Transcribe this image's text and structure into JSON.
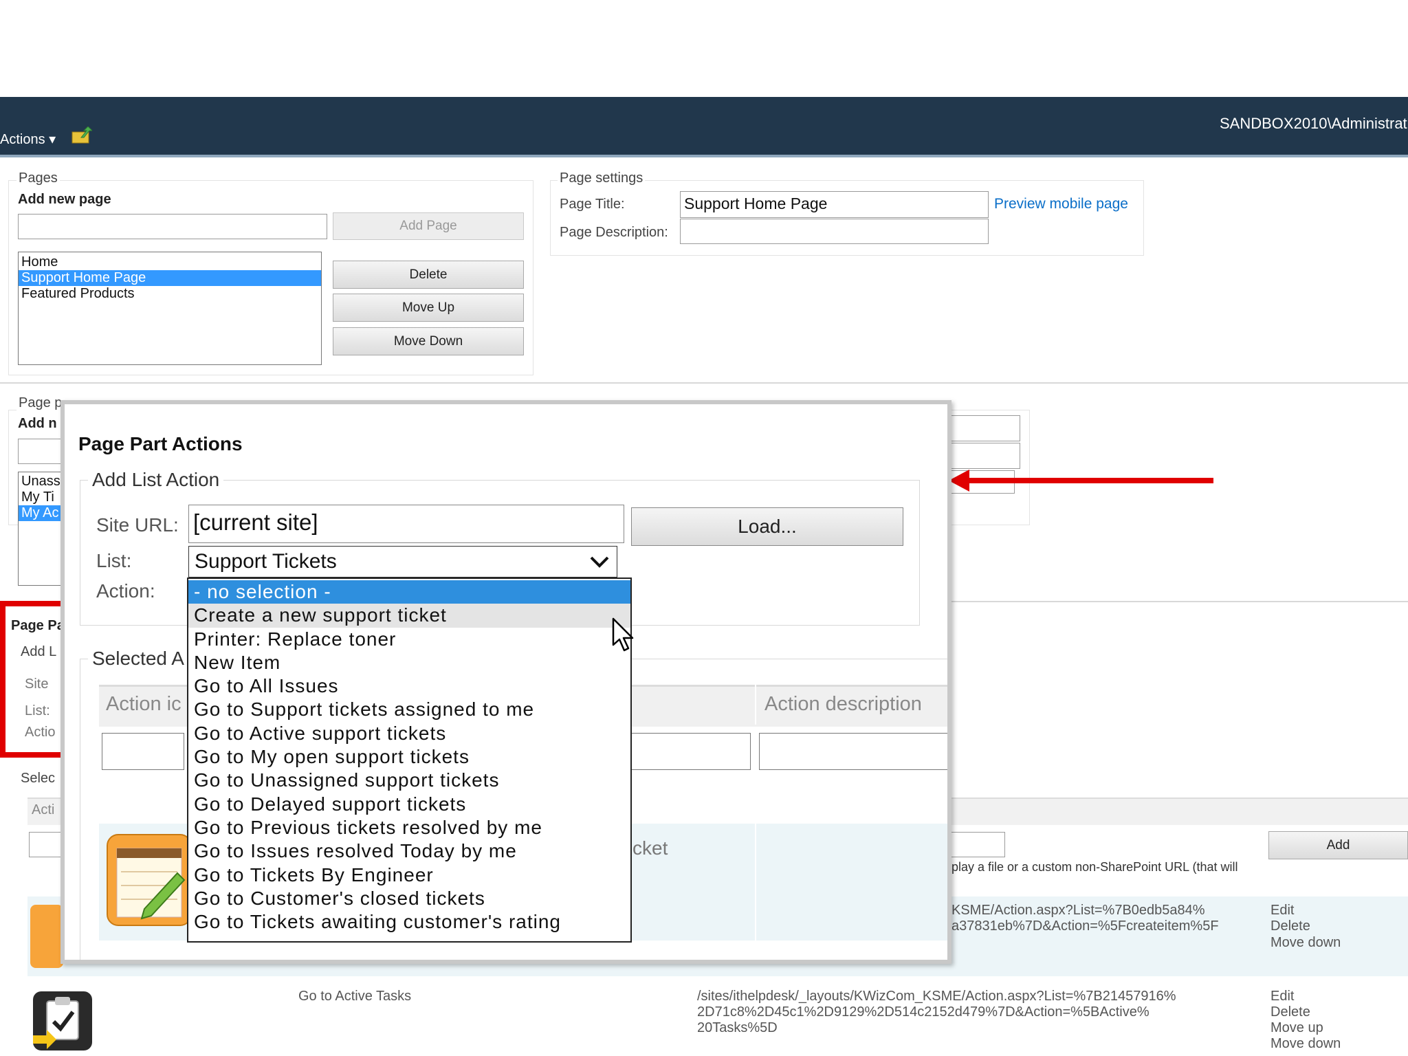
{
  "ribbon": {
    "actions_label": "Actions ▾",
    "upload_icon": "upload-folder-icon",
    "user": "SANDBOX2010\\Administrat"
  },
  "pages_panel": {
    "legend": "Pages",
    "add_new_label": "Add new page",
    "new_page_value": "",
    "add_page_button": "Add Page",
    "pages": [
      "Home",
      "Support Home Page",
      "Featured Products"
    ],
    "selected_index": 1,
    "delete_button": "Delete",
    "move_up_button": "Move Up",
    "move_down_button": "Move Down"
  },
  "page_settings": {
    "legend": "Page settings",
    "title_label": "Page Title:",
    "title_value": "Support Home Page",
    "description_label": "Page Description:",
    "description_value": "",
    "preview_link": "Preview mobile page"
  },
  "page_parts_panel": {
    "legend_partial": "Page p",
    "add_new_partial": "Add n",
    "items_partial": [
      "Unass",
      "My Ti",
      "My Ac"
    ]
  },
  "bg_lower": {
    "page_part_label": "Page Pa",
    "add_label": "Add L",
    "site_label": "Site",
    "list_label": "List:",
    "action_label": "Actio",
    "selected_label": "Selec",
    "acti_header": "Acti",
    "ticket_frag": "cket",
    "add_button": "Add",
    "help_text": "play a file or a custom non-SharePoint URL (that will",
    "row1_url_1": "KSME/Action.aspx?List=%7B0edb5a84%",
    "row1_url_2": "a37831eb%7D&Action=%5Fcreateitem%5F",
    "row1_links": [
      "Edit",
      "Delete",
      "Move down"
    ],
    "row2_title": "Go to Active Tasks",
    "row2_url": [
      "/sites/ithelpdesk/_layouts/KWizCom_KSME/Action.aspx?List=%7B21457916%",
      "2D71c8%2D45c1%2D9129%2D514c2152d479%7D&Action=%5BActive%",
      "20Tasks%5D"
    ],
    "row2_links": [
      "Edit",
      "Delete",
      "Move up",
      "Move down"
    ]
  },
  "modal": {
    "title": "Page Part Actions",
    "add_legend": "Add List Action",
    "site_url_label": "Site URL:",
    "site_url_value": "[current site]",
    "load_button": "Load...",
    "list_label": "List:",
    "list_value": "Support Tickets",
    "action_label": "Action:",
    "selected_legend": "Selected A",
    "col_action_icon": "Action ic",
    "col_action_description": "Action description"
  },
  "action_dropdown": {
    "options": [
      "- no selection -",
      "Create a new support ticket",
      "Printer: Replace toner",
      "New Item",
      "Go to All Issues",
      "Go to Support tickets assigned to me",
      "Go to Active support tickets",
      "Go to My open support tickets",
      "Go to Unassigned support tickets",
      "Go to Delayed support tickets",
      "Go to Previous tickets resolved by me",
      "Go to Issues resolved Today by me",
      "Go to Tickets By Engineer",
      "Go to Customer's closed tickets",
      "Go to Tickets awaiting customer's rating"
    ],
    "selected_index": 0,
    "hover_index": 1
  },
  "colors": {
    "ribbon": "#21374c",
    "selection": "#3399ff",
    "highlight_red": "#e00000",
    "link": "#0a6ec8"
  }
}
